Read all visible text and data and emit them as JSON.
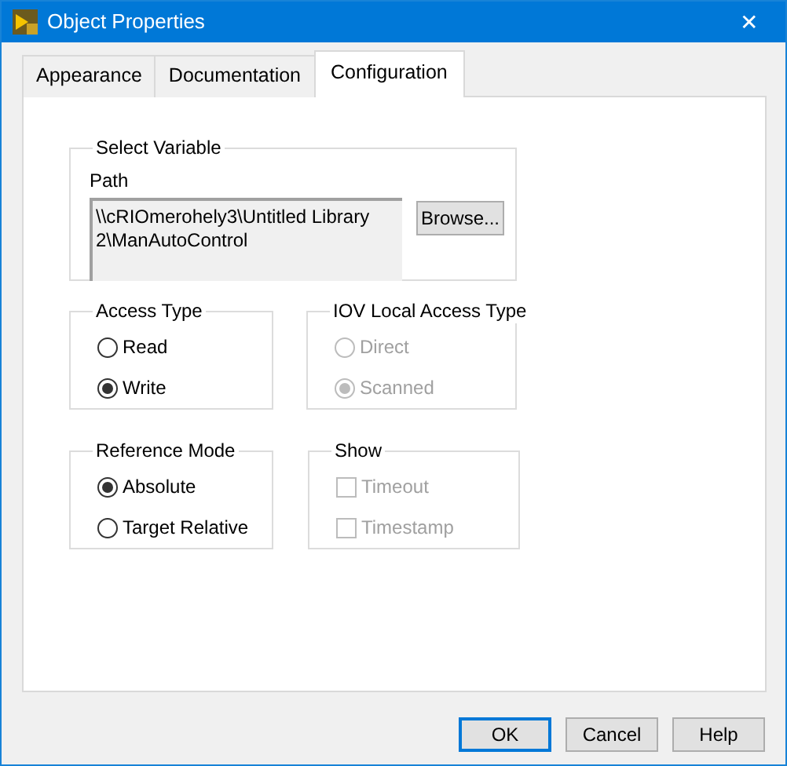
{
  "window": {
    "title": "Object Properties",
    "close": "✕"
  },
  "tabs": [
    {
      "label": "Appearance",
      "selected": false
    },
    {
      "label": "Documentation",
      "selected": false
    },
    {
      "label": "Configuration",
      "selected": true
    }
  ],
  "select_variable": {
    "legend": "Select Variable",
    "path_label": "Path",
    "path_value": "\\\\cRIOmerohely3\\Untitled Library 2\\ManAutoControl",
    "browse_button": "Browse..."
  },
  "access_type": {
    "legend": "Access Type",
    "disabled": false,
    "options": [
      {
        "label": "Read",
        "selected": false
      },
      {
        "label": "Write",
        "selected": true
      }
    ]
  },
  "iov_local_access_type": {
    "legend": "IOV Local Access Type",
    "disabled": true,
    "options": [
      {
        "label": "Direct",
        "selected": false
      },
      {
        "label": "Scanned",
        "selected": true
      }
    ]
  },
  "reference_mode": {
    "legend": "Reference Mode",
    "disabled": false,
    "options": [
      {
        "label": "Absolute",
        "selected": true
      },
      {
        "label": "Target Relative",
        "selected": false
      }
    ]
  },
  "show": {
    "legend": "Show",
    "disabled": true,
    "options": [
      {
        "label": "Timeout",
        "checked": false
      },
      {
        "label": "Timestamp",
        "checked": false
      }
    ]
  },
  "buttons": [
    {
      "label": "OK",
      "default": true
    },
    {
      "label": "Cancel",
      "default": false
    },
    {
      "label": "Help",
      "default": false
    }
  ]
}
